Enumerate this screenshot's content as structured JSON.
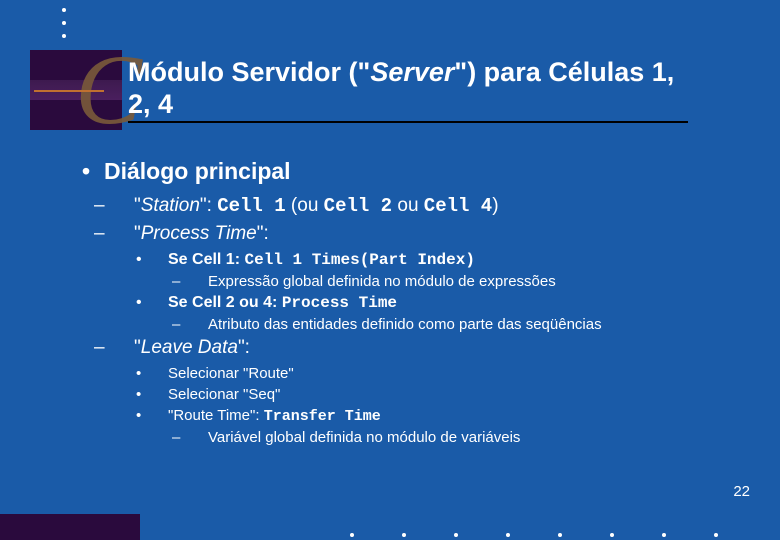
{
  "title": {
    "pre": "Módulo Servidor (\"",
    "mid": "Server",
    "post": "\") para Células 1, 2, 4"
  },
  "l1": "Diálogo principal",
  "station": {
    "pre": "\"",
    "it": "Station",
    "post": "\": ",
    "c1": "Cell 1",
    "ou1": " (ou ",
    "c2": "Cell 2",
    "ou2": " ou ",
    "c4": "Cell 4",
    "end": ")"
  },
  "ptime": {
    "pre": "\"",
    "it": "Process Time",
    "post": "\":"
  },
  "cell1": {
    "pre": "Se Cell 1: ",
    "mono": "Cell 1 Times(Part Index)"
  },
  "cell1note": "Expressão global definida no módulo de expressões",
  "cell24": {
    "pre": "Se Cell 2 ou 4: ",
    "mono": "Process Time"
  },
  "cell24note": "Atributo das entidades definido como parte das seqüências",
  "leave": {
    "pre": "\"",
    "it": "Leave Data",
    "post": "\":"
  },
  "route": "Selecionar \"Route\"",
  "seq": "Selecionar \"Seq\"",
  "rtime": {
    "pre": "\"Route Time\": ",
    "mono": "Transfer Time"
  },
  "rtimenote": "Variável global definida no módulo de variáveis",
  "page": "22",
  "dash": "–",
  "dot": "•"
}
